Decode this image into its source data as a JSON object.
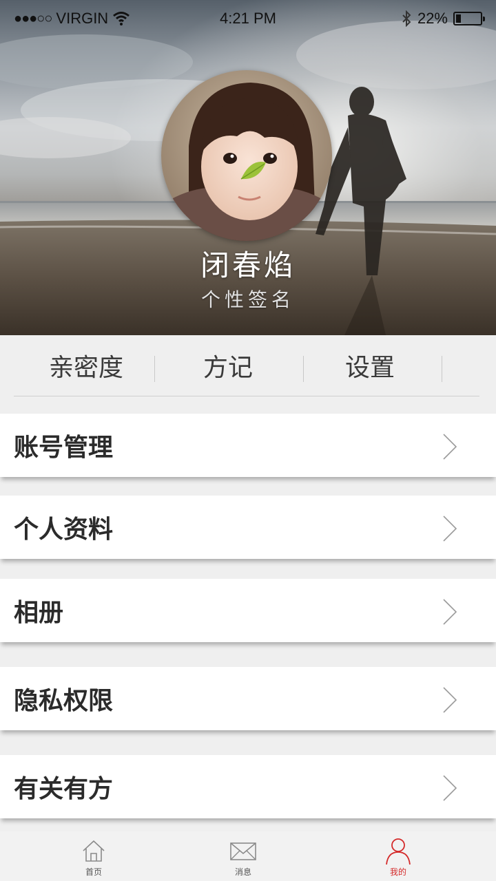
{
  "status_bar": {
    "signal": "●●●○○",
    "carrier": "VIRGIN",
    "time": "4:21 PM",
    "battery": "22%",
    "battery_level": 0.22,
    "icons": [
      "wifi-icon",
      "bluetooth-icon",
      "battery-icon"
    ]
  },
  "profile": {
    "name": "闭春焰",
    "signature": "个性签名"
  },
  "top_tabs": [
    {
      "label": "亲密度"
    },
    {
      "label": "方记"
    },
    {
      "label": "设置"
    }
  ],
  "menu": [
    {
      "label": "账号管理",
      "icon": "chevron-right-icon"
    },
    {
      "label": "个人资料",
      "icon": "chevron-right-icon"
    },
    {
      "label": "相册",
      "icon": "chevron-right-icon"
    },
    {
      "label": "隐私权限",
      "icon": "chevron-right-icon"
    },
    {
      "label": "有关有方",
      "icon": "chevron-right-icon"
    }
  ],
  "tab_bar": {
    "items": [
      {
        "label": "首页",
        "icon": "home-icon"
      },
      {
        "label": "消息",
        "icon": "envelope-icon"
      },
      {
        "label": "我的",
        "icon": "person-icon",
        "active": true
      }
    ]
  },
  "colors": {
    "accent": "#d42a2a",
    "background": "#efefef",
    "card": "#ffffff"
  }
}
